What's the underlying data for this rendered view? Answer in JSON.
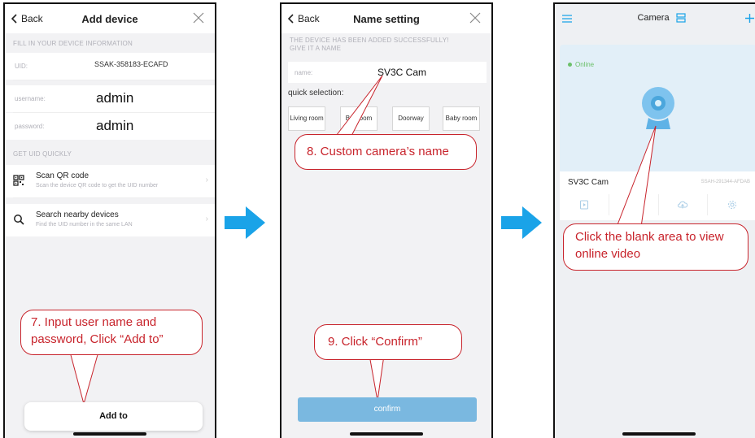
{
  "screen1": {
    "back": "Back",
    "title": "Add device",
    "section_info": "FILL IN YOUR DEVICE INFORMATION",
    "uid_label": "UID:",
    "uid_value": "SSAK-358183-ECAFD",
    "username_label": "username:",
    "username_value": "admin",
    "password_label": "password:",
    "password_value": "admin",
    "section_quick": "GET UID QUICKLY",
    "scan_title": "Scan QR code",
    "scan_sub": "Scan the device QR code to get the UID number",
    "search_title": "Search nearby devices",
    "search_sub": "Find the UID number in the same LAN",
    "add_button": "Add to",
    "callout": "7. Input user name and password, Click “Add to”"
  },
  "screen2": {
    "back": "Back",
    "title": "Name setting",
    "notice": "THE DEVICE HAS BEEN ADDED SUCCESSFULLY! GIVE IT A NAME",
    "name_label": "name:",
    "name_value": "SV3C Cam",
    "quick_label": "quick selection:",
    "chips": [
      "Living room",
      "Bedroom",
      "Doorway",
      "Baby room"
    ],
    "confirm_button": "confirm",
    "callout_name": "8. Custom camera’s name",
    "callout_confirm": "9. Click “Confirm”"
  },
  "screen3": {
    "title": "Camera",
    "status": "Online",
    "camera_name": "SV3C Cam",
    "camera_uid": "SSAH-291344-AFDAB",
    "callout": "Click the blank area to view online video"
  },
  "colors": {
    "accent": "#1aa3e8",
    "callout": "#c8242c",
    "online": "#6cc06a",
    "confirm": "#7ab8e0"
  },
  "icons": [
    "chevron-left-icon",
    "close-icon",
    "qr-code-icon",
    "search-icon",
    "chevron-right-icon",
    "menu-icon",
    "list-icon",
    "plus-icon",
    "camera-icon",
    "playback-icon",
    "cloud-icon",
    "settings-icon",
    "arrow-right-icon"
  ]
}
